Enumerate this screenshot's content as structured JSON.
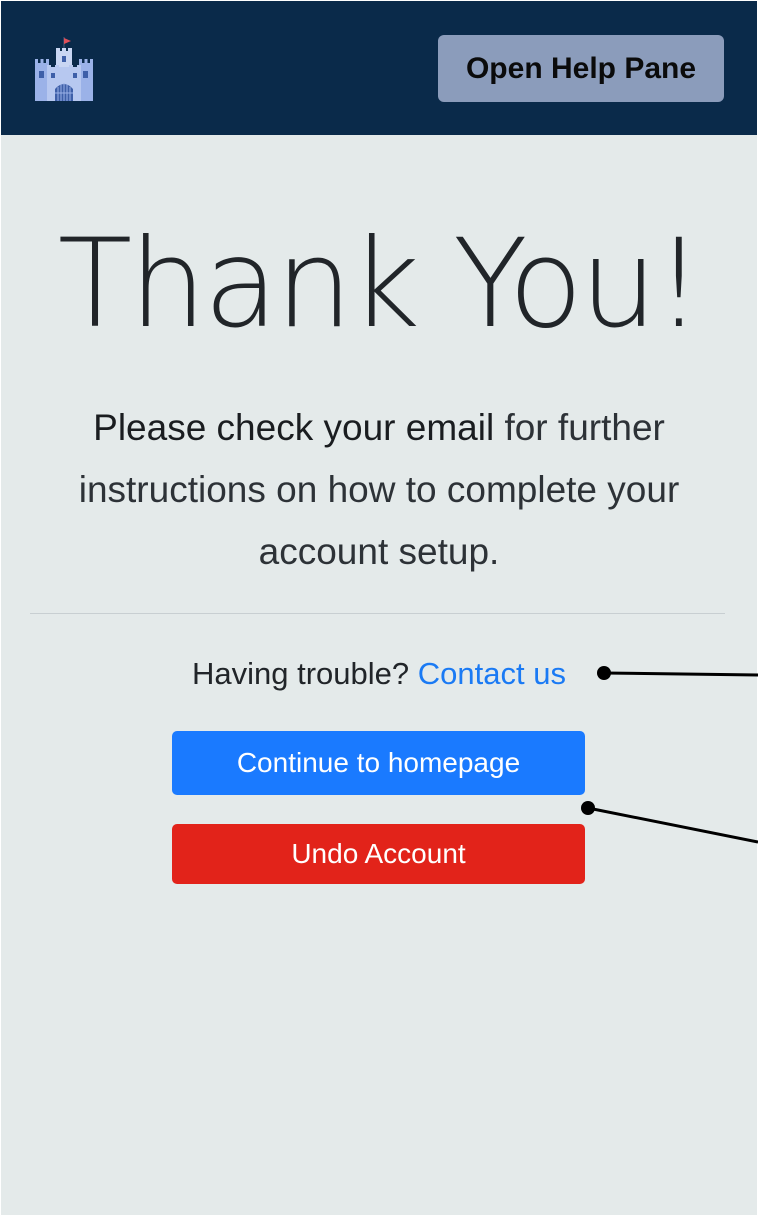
{
  "header": {
    "logo_icon": "castle-icon",
    "help_button_label": "Open Help Pane",
    "background_color": "#0a2a4a",
    "help_button_color": "#8b9cbb"
  },
  "main": {
    "title": "Thank You!",
    "message_emphasis": "Please check your email",
    "message_rest": "for further instructions on how to complete your account setup.",
    "trouble_text": "Having trouble?",
    "contact_link": "Contact us",
    "continue_button_label": "Continue to homepage",
    "undo_button_label": "Undo Account",
    "primary_color": "#1a7aff",
    "danger_color": "#e2231a",
    "background_color": "#e4eaea"
  }
}
